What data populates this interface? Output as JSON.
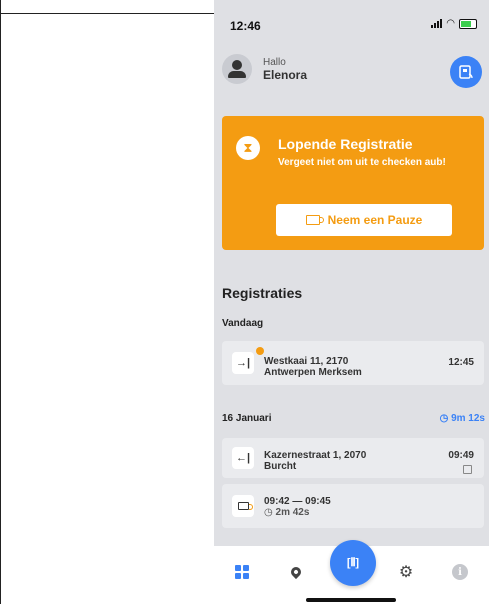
{
  "status": {
    "time": "12:46"
  },
  "header": {
    "greeting": "Hallo",
    "user_name": "Elenora",
    "card_icon": "card-scan-icon"
  },
  "banner": {
    "title": "Lopende Registratie",
    "subtitle": "Vergeet niet om uit te checken aub!",
    "pause_label": "Neem een Pauze",
    "color": "#f49c12"
  },
  "registrations": {
    "title": "Registraties",
    "today_label": "Vandaag",
    "today_items": [
      {
        "icon": "check-in-icon",
        "glyph": "→|",
        "address_line1": "Westkaai 11, 2170",
        "address_line2": "Antwerpen Merksem",
        "time": "12:45"
      }
    ],
    "day2_label": "16 Januari",
    "day2_duration": "9m 12s",
    "day2_items": [
      {
        "icon": "check-out-icon",
        "glyph": "←|",
        "address_line1": "Kazernestraat 1, 2070",
        "address_line2": "Burcht",
        "time": "09:49"
      },
      {
        "icon": "pause-cup-icon",
        "range": "09:42  —  09:45",
        "duration": "2m 42s"
      }
    ]
  },
  "nav": {
    "items": [
      "dashboard-icon",
      "location-icon",
      "scan-icon",
      "settings-icon",
      "info-icon"
    ],
    "accent": "#3b82f6"
  }
}
